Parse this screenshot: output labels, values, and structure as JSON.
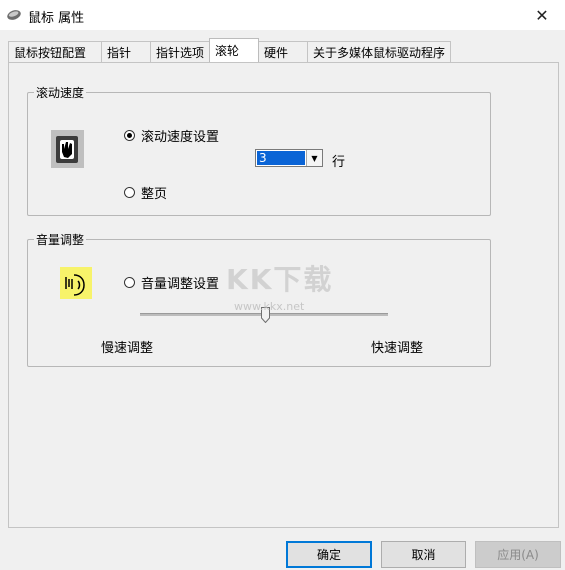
{
  "window": {
    "title": "鼠标 属性",
    "close_glyph": "✕"
  },
  "tabs": [
    {
      "label": "鼠标按钮配置"
    },
    {
      "label": "指针"
    },
    {
      "label": "指针选项"
    },
    {
      "label": "滚轮"
    },
    {
      "label": "硬件"
    },
    {
      "label": "关于多媒体鼠标驱动程序"
    }
  ],
  "active_tab": "滚轮",
  "scroll_group": {
    "title": "滚动速度",
    "radio_lines_label": "滚动速度设置",
    "radio_lines_checked": true,
    "lines_value": "3",
    "lines_unit": "行",
    "radio_page_label": "整页",
    "radio_page_checked": false
  },
  "volume_group": {
    "title": "音量调整",
    "radio_label": "音量调整设置",
    "radio_checked": false,
    "slow_label": "慢速调整",
    "fast_label": "快速调整",
    "slider_position": 0.5
  },
  "watermark": {
    "big": "KK下载",
    "small": "www.kkx.net"
  },
  "buttons": {
    "ok": "确定",
    "cancel": "取消",
    "apply": "应用(A)"
  }
}
